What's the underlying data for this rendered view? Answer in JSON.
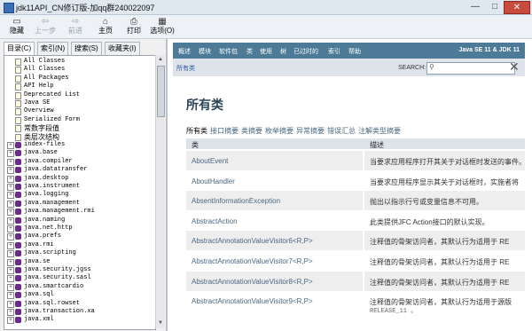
{
  "window": {
    "title": "jdk11API_CN修订版-加qq群240022097",
    "buttons": {
      "minimize": "—",
      "maximize": "□",
      "close": "✕"
    }
  },
  "toolbar": {
    "items": [
      {
        "label": "隐藏",
        "icon": "hide-icon",
        "enabled": true
      },
      {
        "label": "上一步",
        "icon": "back-icon",
        "enabled": false
      },
      {
        "label": "前进",
        "icon": "forward-icon",
        "enabled": false
      },
      {
        "label": "主页",
        "icon": "home-icon",
        "enabled": true
      },
      {
        "label": "打印",
        "icon": "print-icon",
        "enabled": true
      },
      {
        "label": "选项(O)",
        "icon": "options-icon",
        "enabled": true
      }
    ]
  },
  "left_panel": {
    "tabs": [
      "目录(C)",
      "索引(N)",
      "搜索(S)",
      "收藏夹(I)"
    ],
    "active_tab": 0,
    "tree": [
      {
        "text": "All Classes",
        "type": "doc"
      },
      {
        "text": "All Classes",
        "type": "doc"
      },
      {
        "text": "All Packages",
        "type": "doc"
      },
      {
        "text": "API Help",
        "type": "doc"
      },
      {
        "text": "Deprecated List",
        "type": "doc"
      },
      {
        "text": "Java SE",
        "type": "doc"
      },
      {
        "text": "Overview",
        "type": "doc"
      },
      {
        "text": "Serialized Form",
        "type": "doc"
      },
      {
        "text": "常数字段值",
        "type": "doc"
      },
      {
        "text": "类层次结构",
        "type": "doc"
      },
      {
        "text": "index-files",
        "type": "pkg"
      },
      {
        "text": "java.base",
        "type": "pkg"
      },
      {
        "text": "java.compiler",
        "type": "pkg"
      },
      {
        "text": "java.datatransfer",
        "type": "pkg"
      },
      {
        "text": "java.desktop",
        "type": "pkg"
      },
      {
        "text": "java.instrument",
        "type": "pkg"
      },
      {
        "text": "java.logging",
        "type": "pkg"
      },
      {
        "text": "java.management",
        "type": "pkg"
      },
      {
        "text": "java.management.rmi",
        "type": "pkg"
      },
      {
        "text": "java.naming",
        "type": "pkg"
      },
      {
        "text": "java.net.http",
        "type": "pkg"
      },
      {
        "text": "java.prefs",
        "type": "pkg"
      },
      {
        "text": "java.rmi",
        "type": "pkg"
      },
      {
        "text": "java.scripting",
        "type": "pkg"
      },
      {
        "text": "java.se",
        "type": "pkg"
      },
      {
        "text": "java.security.jgss",
        "type": "pkg"
      },
      {
        "text": "java.security.sasl",
        "type": "pkg"
      },
      {
        "text": "java.smartcardio",
        "type": "pkg"
      },
      {
        "text": "java.sql",
        "type": "pkg"
      },
      {
        "text": "java.sql.rowset",
        "type": "pkg"
      },
      {
        "text": "java.transaction.xa",
        "type": "pkg"
      },
      {
        "text": "java.xml",
        "type": "pkg"
      }
    ]
  },
  "content": {
    "nav": [
      "概述",
      "模块",
      "软件包",
      "类",
      "使用",
      "树",
      "已过时的",
      "索引",
      "帮助"
    ],
    "nav_right": "Java SE 11 & JDK 11",
    "breadcrumb": "所有类",
    "search_label": "SEARCH:",
    "search_value": "",
    "heading": "所有类",
    "filters": [
      "所有类",
      "接口摘要",
      "类摘要",
      "枚举摘要",
      "异常摘要",
      "错误汇总",
      "注解类型摘要"
    ],
    "table_headers": [
      "类",
      "描述"
    ],
    "rows": [
      {
        "cls": "AboutEvent",
        "desc": "当要求应用程序打开其关于对话框时发送的事件。"
      },
      {
        "cls": "AboutHandler",
        "desc": "当要求应用程序显示其关于对话框时，实施者将"
      },
      {
        "cls": "AbsentInformationException",
        "desc": "抛出以指示行号或变量信息不可用。"
      },
      {
        "cls": "AbstractAction",
        "desc": "此类提供JFC Action接口的默认实现。"
      },
      {
        "cls": "AbstractAnnotationValueVisitor6<R,P>",
        "desc": "注释值的骨架访问者，其默认行为适用于 RE"
      },
      {
        "cls": "AbstractAnnotationValueVisitor7<R,P>",
        "desc": "注释值的骨架访问者，其默认行为适用于 RE"
      },
      {
        "cls": "AbstractAnnotationValueVisitor8<R,P>",
        "desc": "注释值的骨架访问者，其默认行为适用于 RE"
      },
      {
        "cls": "AbstractAnnotationValueVisitor9<R,P>",
        "desc": "注释值的骨架访问者，其默认行为适用于源版",
        "desc2": "RELEASE_11 。"
      }
    ]
  },
  "colors": {
    "nav_bg": "#4d7a97",
    "subnav_bg": "#dee3e9",
    "link": "#4a6782"
  }
}
